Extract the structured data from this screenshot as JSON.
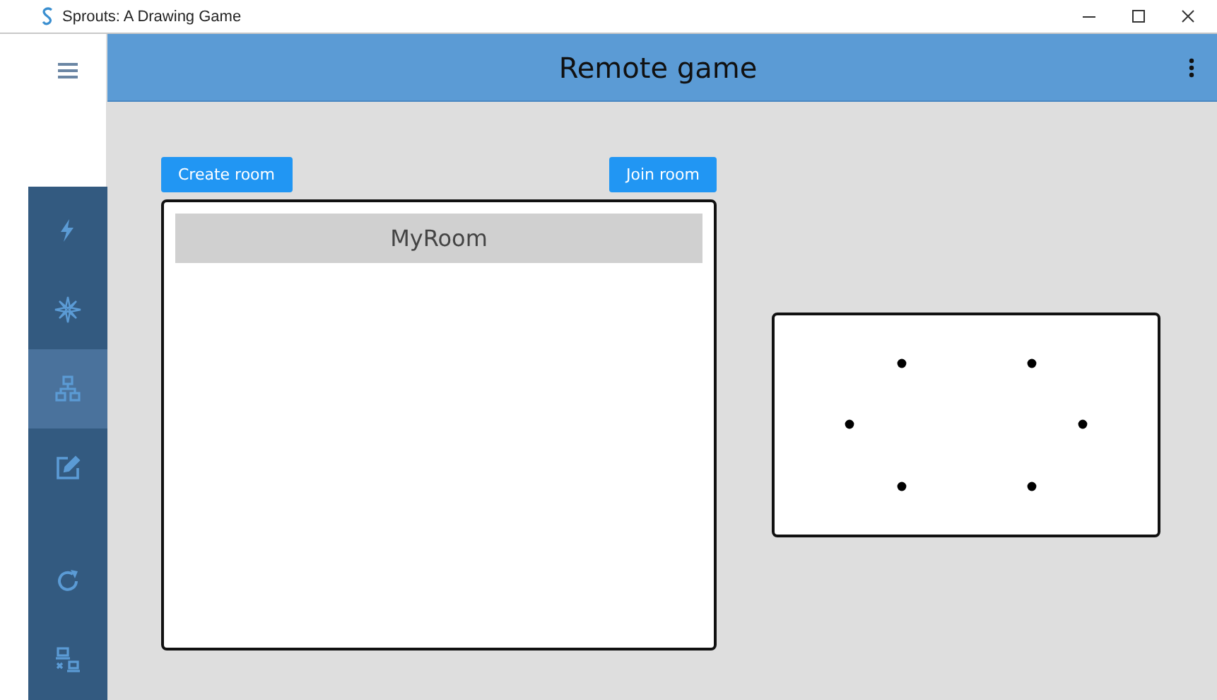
{
  "window": {
    "title": "Sprouts: A Drawing Game"
  },
  "header": {
    "title": "Remote game"
  },
  "sidebar": {
    "items": [
      {
        "kind": "lightning",
        "selected": false
      },
      {
        "kind": "compass",
        "selected": false
      },
      {
        "kind": "network",
        "selected": true
      },
      {
        "kind": "edit",
        "selected": false
      },
      {
        "kind": "refresh",
        "selected": false
      },
      {
        "kind": "disconnect",
        "selected": false
      }
    ]
  },
  "buttons": [
    "Create room",
    "Join room"
  ],
  "rooms": [
    {
      "name": "MyRoom",
      "selected": true
    }
  ]
}
